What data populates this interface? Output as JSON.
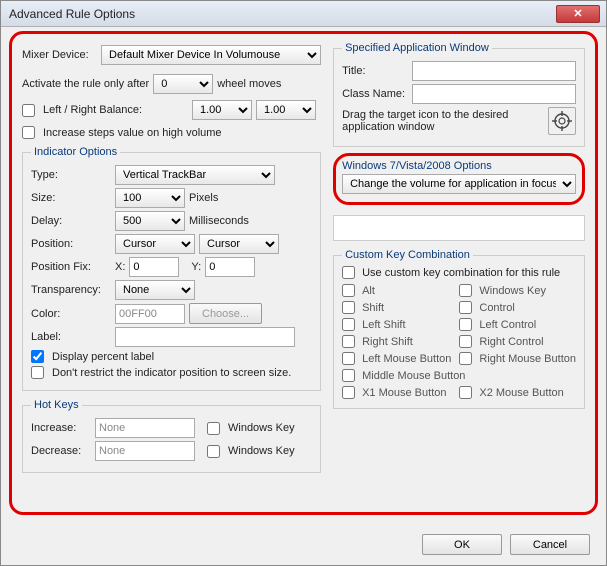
{
  "title": "Advanced Rule Options",
  "mixer": {
    "label": "Mixer Device:",
    "value": "Default Mixer Device In Volumouse"
  },
  "activate": {
    "prefix": "Activate the rule only after",
    "value": "0",
    "suffix": "wheel moves"
  },
  "lrbalance": {
    "label": "Left / Right Balance:",
    "v1": "1.00",
    "v2": "1.00",
    "checked": false
  },
  "increase_steps": {
    "label": "Increase steps value on high volume",
    "checked": false
  },
  "indicator": {
    "legend": "Indicator Options",
    "type_label": "Type:",
    "type_value": "Vertical TrackBar",
    "size_label": "Size:",
    "size_value": "100",
    "size_unit": "Pixels",
    "delay_label": "Delay:",
    "delay_value": "500",
    "delay_unit": "Milliseconds",
    "position_label": "Position:",
    "pos1": "Cursor",
    "pos2": "Cursor",
    "posfix_label": "Position Fix:",
    "posfix_xlabel": "X:",
    "posfix_x": "0",
    "posfix_ylabel": "Y:",
    "posfix_y": "0",
    "transp_label": "Transparency:",
    "transp_value": "None",
    "color_label": "Color:",
    "color_value": "00FF00",
    "choose": "Choose...",
    "label_label": "Label:",
    "label_value": "",
    "display_percent": {
      "label": "Display percent label",
      "checked": true
    },
    "dont_restrict": {
      "label": "Don't restrict the indicator position to screen size.",
      "checked": false
    }
  },
  "hotkeys": {
    "legend": "Hot Keys",
    "increase_label": "Increase:",
    "increase_value": "None",
    "decrease_label": "Decrease:",
    "decrease_value": "None",
    "winkey": "Windows Key"
  },
  "appwin": {
    "legend": "Specified Application Window",
    "title_label": "Title:",
    "title_value": "",
    "class_label": "Class Name:",
    "class_value": "",
    "drag_text": "Drag the target icon to the desired application window"
  },
  "win7": {
    "legend": "Windows 7/Vista/2008 Options",
    "value": "Change the volume for application in focus"
  },
  "customkey": {
    "legend": "Custom Key Combination",
    "use_label": "Use custom key combination for this rule",
    "keys": {
      "alt": "Alt",
      "winkey": "Windows Key",
      "shift": "Shift",
      "control": "Control",
      "lshift": "Left Shift",
      "lcontrol": "Left Control",
      "rshift": "Right Shift",
      "rcontrol": "Right Control",
      "lmb": "Left Mouse Button",
      "rmb": "Right Mouse Button",
      "mmb": "Middle Mouse Button",
      "x1": "X1 Mouse Button",
      "x2": "X2 Mouse Button"
    }
  },
  "buttons": {
    "ok": "OK",
    "cancel": "Cancel"
  }
}
